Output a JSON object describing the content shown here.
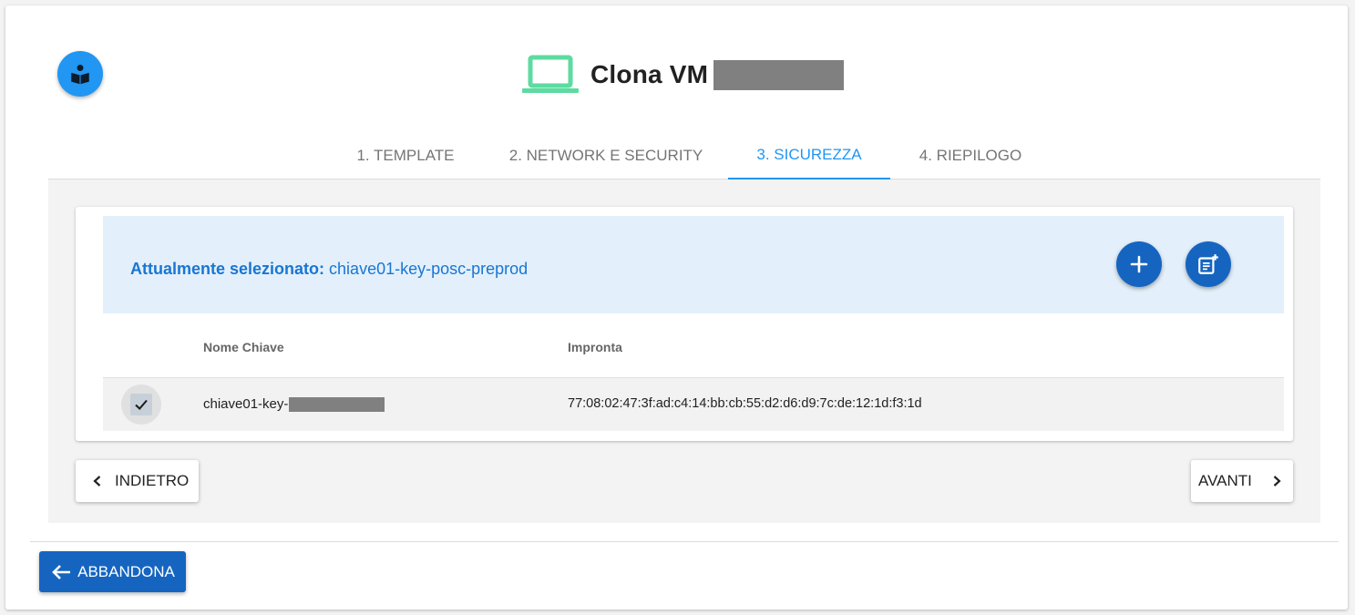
{
  "header": {
    "title": "Clona VM",
    "laptop_icon": "laptop-icon",
    "accent": "#5ddba0"
  },
  "tabs": [
    {
      "label": "1. TEMPLATE",
      "active": false
    },
    {
      "label": "2. NETWORK E SECURITY",
      "active": false
    },
    {
      "label": "3. SICUREZZA",
      "active": true
    },
    {
      "label": "4. RIEPILOGO",
      "active": false
    }
  ],
  "selection": {
    "label": "Attualmente selezionato:",
    "value": "chiave01-key-posc-preprod"
  },
  "table": {
    "columns": [
      "Nome Chiave",
      "Impronta"
    ],
    "rows": [
      {
        "selected": true,
        "name_prefix": "chiave01-key-",
        "fingerprint": "77:08:02:47:3f:ad:c4:14:bb:cb:55:d2:d6:d9:7c:de:12:1d:f3:1d"
      }
    ]
  },
  "navigation": {
    "back_label": "INDIETRO",
    "next_label": "AVANTI",
    "abandon_label": "ABBANDONA"
  },
  "colors": {
    "primary": "#1565c0",
    "active_tab": "#2196f3",
    "banner_bg": "#e3f0fb"
  }
}
